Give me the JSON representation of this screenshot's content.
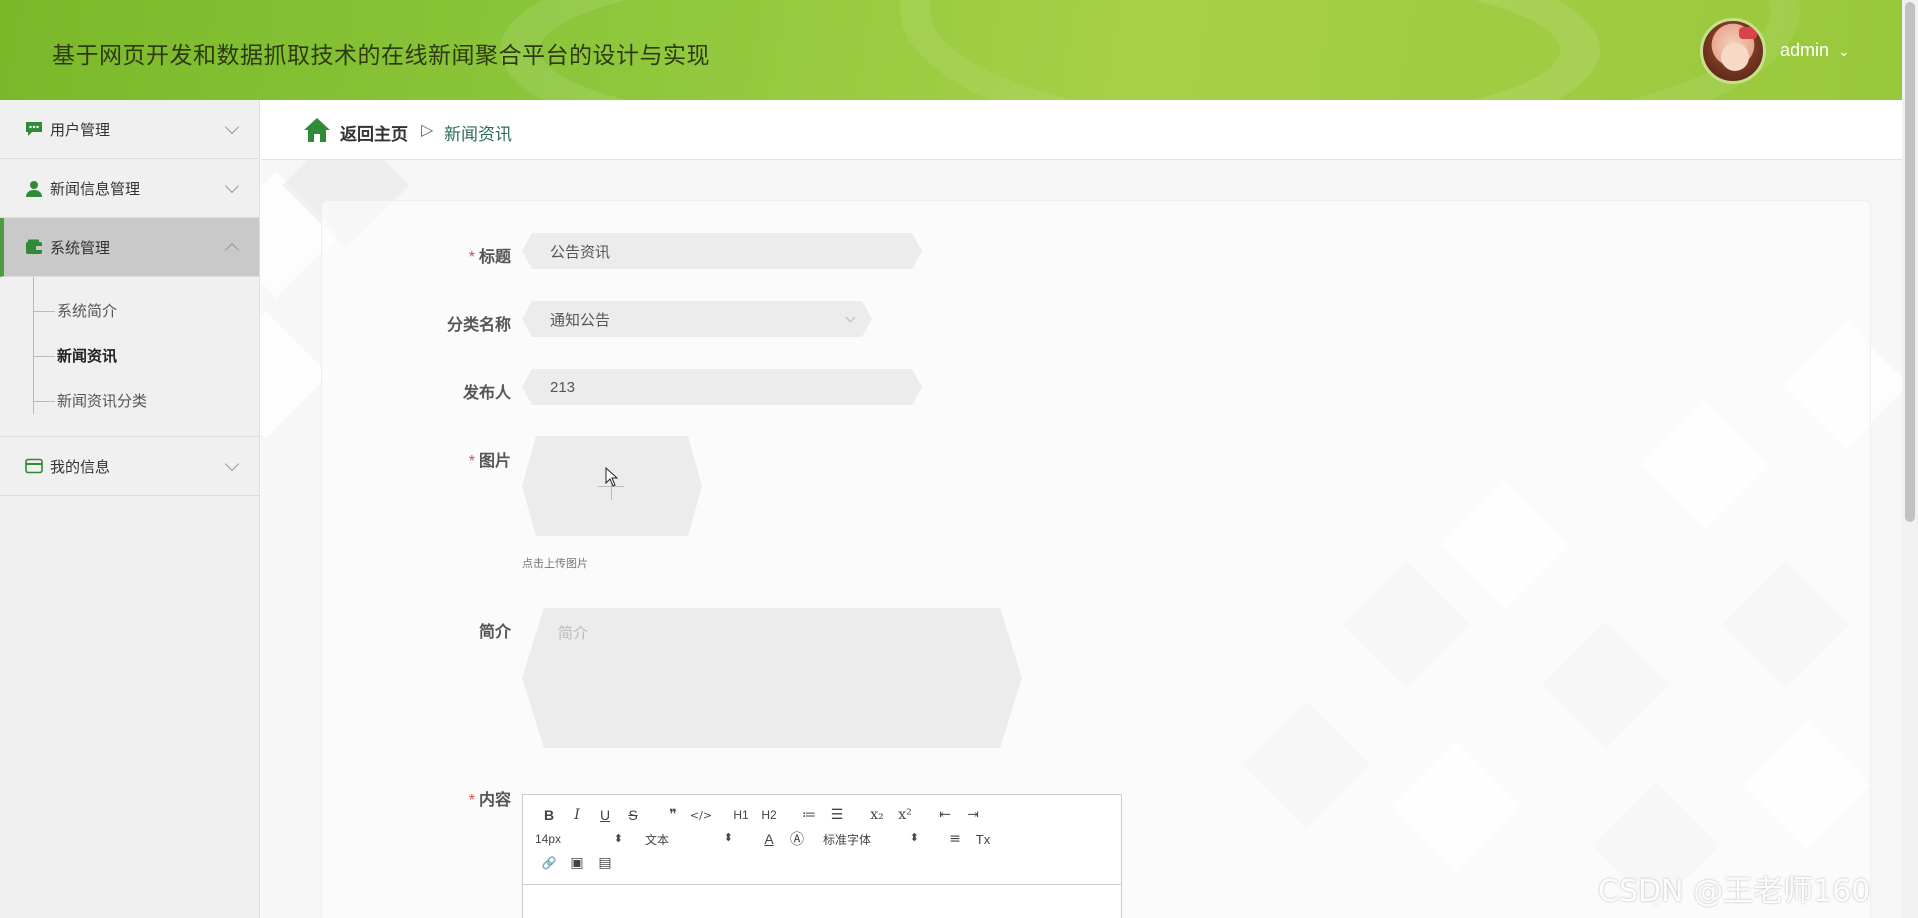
{
  "header": {
    "title": "基于网页开发和数据抓取技术的在线新闻聚合平台的设计与实现",
    "username": "admin",
    "user_chevron": "⌄"
  },
  "sidebar": {
    "items": [
      {
        "label": "用户管理",
        "icon": "chat-icon"
      },
      {
        "label": "新闻信息管理",
        "icon": "user-icon"
      },
      {
        "label": "系统管理",
        "icon": "wallet-icon",
        "active": true,
        "children": [
          "系统简介",
          "新闻资讯",
          "新闻资讯分类"
        ],
        "current_child": "新闻资讯"
      },
      {
        "label": "我的信息",
        "icon": "card-icon"
      }
    ]
  },
  "breadcrumb": {
    "home": "返回主页",
    "separator": "▷",
    "current": "新闻资讯"
  },
  "form": {
    "title_label": "标题",
    "title_value": "公告资讯",
    "category_label": "分类名称",
    "category_value": "通知公告",
    "publisher_label": "发布人",
    "publisher_value": "213",
    "image_label": "图片",
    "image_hint": "点击上传图片",
    "summary_label": "简介",
    "summary_placeholder": "简介",
    "content_label": "内容",
    "required_mark": "*"
  },
  "editor": {
    "row1": [
      "B",
      "I",
      "U",
      "S",
      "❞",
      "</>",
      "H1",
      "H2",
      "≔",
      "☰",
      "x₂",
      "x²",
      "⇤",
      "⇥"
    ],
    "font_size": "14px",
    "block_type": "文本",
    "font_family": "标准字体",
    "row2_icons": [
      "A",
      "Ⓐ",
      "≡",
      "Tx"
    ],
    "row3": [
      "🔗",
      "▣",
      "▤"
    ]
  },
  "watermark": "CSDN @王老师160",
  "colors": {
    "header_green": "#8cc63a",
    "accent_green": "#4c9a42",
    "required_red": "#e5484d"
  }
}
